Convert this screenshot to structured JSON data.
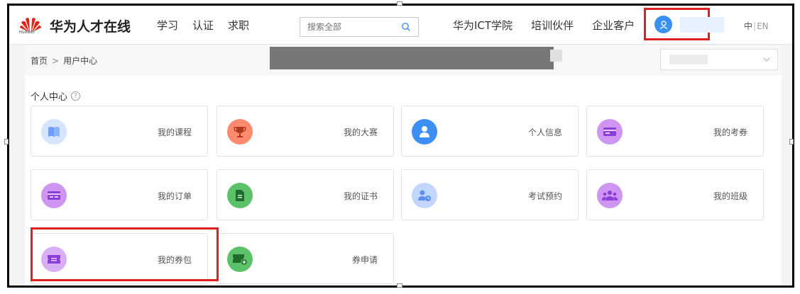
{
  "header": {
    "brand_name": "华为人才在线",
    "logo_sub": "HUAWEI",
    "nav_left": [
      "学习",
      "认证",
      "求职"
    ],
    "search_placeholder": "搜索全部",
    "nav_right": [
      "华为ICT学院",
      "培训伙伴",
      "企业客户"
    ],
    "lang_zh": "中",
    "lang_sep": "|",
    "lang_en": "EN"
  },
  "breadcrumb": {
    "home": "首页",
    "separator": ">",
    "current": "用户中心"
  },
  "section": {
    "title": "个人中心",
    "help_glyph": "?"
  },
  "cards": [
    {
      "label": "我的课程",
      "icon": "book-icon",
      "color": "#c9dcff"
    },
    {
      "label": "我的大赛",
      "icon": "trophy-icon",
      "color": "#ff8a6e"
    },
    {
      "label": "个人信息",
      "icon": "user-icon",
      "color": "#3d8ff5"
    },
    {
      "label": "我的考券",
      "icon": "ticket-icon",
      "color": "#c98df0"
    },
    {
      "label": "我的订单",
      "icon": "order-card-icon",
      "color": "#c98df0"
    },
    {
      "label": "我的证书",
      "icon": "certificate-icon",
      "color": "#5bc26a"
    },
    {
      "label": "考试预约",
      "icon": "user-clock-icon",
      "color": "#bcd3ff"
    },
    {
      "label": "我的班级",
      "icon": "group-icon",
      "color": "#c98df0"
    },
    {
      "label": "我的券包",
      "icon": "coupon-icon",
      "color": "#c98df0"
    },
    {
      "label": "券申请",
      "icon": "coupon-add-icon",
      "color": "#5bc26a"
    }
  ],
  "colors": {
    "highlight": "#e02020",
    "avatar": "#3a8ff2"
  }
}
